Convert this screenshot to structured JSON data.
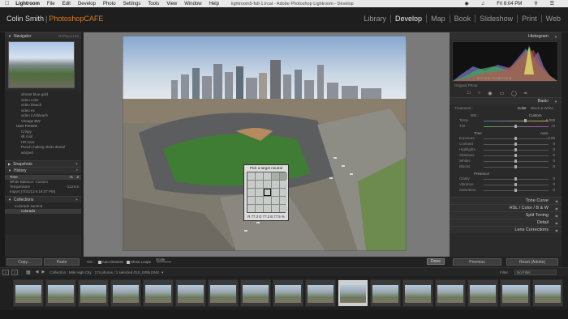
{
  "mac_menu": {
    "app": "Lightroom",
    "items": [
      "File",
      "Edit",
      "Develop",
      "Photo",
      "Settings",
      "Tools",
      "View",
      "Window",
      "Help"
    ],
    "window_title": "lightroom5-full-1.lrcat - Adobe Photoshop Lightroom - Develop",
    "clock": "Fri 6:04 PM"
  },
  "identity": {
    "name": "Colin Smith",
    "sep": "|",
    "brand": "PhotoshopCAFE"
  },
  "modules": [
    "Library",
    "Develop",
    "Map",
    "Book",
    "Slideshow",
    "Print",
    "Web"
  ],
  "active_module": "Develop",
  "left": {
    "navigator": "Navigator",
    "nav_zoom": [
      "FIT",
      "FILL",
      "1:1",
      "3:1"
    ],
    "presets": [
      "vibrant blue gold",
      "video color",
      "video bleach",
      "video ex",
      "video LV4bleach",
      "Vintage BW",
      "User Presets",
      "Crispy",
      "dk cool",
      "HR tone",
      "Punch making shots dental",
      "warped"
    ],
    "snapshots": "Snapshots",
    "history": "History",
    "history_items": [
      {
        "label": "Tone",
        "v1": "+1",
        "v2": "2"
      },
      {
        "label": "White Balance: Custom",
        "v1": "",
        "v2": ""
      },
      {
        "label": "Temperature",
        "v1": "-113",
        "v2": "5,6"
      },
      {
        "label": "Import (7/31/13 6:16:07 PM)",
        "v1": "",
        "v2": ""
      }
    ],
    "collections": "Collections",
    "collection_items": [
      "Colorado summit",
      "colorado"
    ],
    "copy": "Copy...",
    "paste": "Paste"
  },
  "toolbar": {
    "auto_dismiss": "Auto Dismiss",
    "show_loupe": "Show Loupe",
    "scale": "Scale",
    "done": "Done"
  },
  "neutral": {
    "title": "Pick a target neutral",
    "rgb": "R 77.3  G 77.2  B 77.5 %"
  },
  "right": {
    "histogram": "Histogram",
    "hist_values": "R 77.3  G 77.2  B 77.5 %",
    "original_photo": "Original Photo",
    "basic": "Basic",
    "treatment": "Treatment :",
    "color": "Color",
    "bw": "Black & White",
    "wb": "WB :",
    "wb_value": "Custom",
    "temp": "Temp",
    "temp_val": "6,000",
    "tint": "Tint",
    "tint_val": "+2",
    "tone": "Tone",
    "auto": "Auto",
    "tone_sliders": [
      {
        "label": "Exposure",
        "value": "0.00"
      },
      {
        "label": "Contrast",
        "value": "0"
      },
      {
        "label": "Highlights",
        "value": "0"
      },
      {
        "label": "Shadows",
        "value": "0"
      },
      {
        "label": "Whites",
        "value": "0"
      },
      {
        "label": "Blacks",
        "value": "0"
      }
    ],
    "presence": "Presence",
    "presence_sliders": [
      {
        "label": "Clarity",
        "value": "0"
      },
      {
        "label": "Vibrance",
        "value": "0"
      },
      {
        "label": "Saturation",
        "value": "0"
      }
    ],
    "sections": [
      "Tone Curve",
      "HSL / Color / B & W",
      "Split Toning",
      "Detail",
      "Lens Corrections"
    ],
    "previous": "Previous",
    "reset": "Reset (Adobe)"
  },
  "filmbar": {
    "pages": [
      "1",
      "2"
    ],
    "info": "Collection : Mile High City",
    "count": "174 photos / 1 selected /DJI_0055.DNG",
    "filter_label": "Filter :",
    "filter_value": "No Filter"
  },
  "filmstrip_count": 17,
  "filmstrip_selected": 10
}
